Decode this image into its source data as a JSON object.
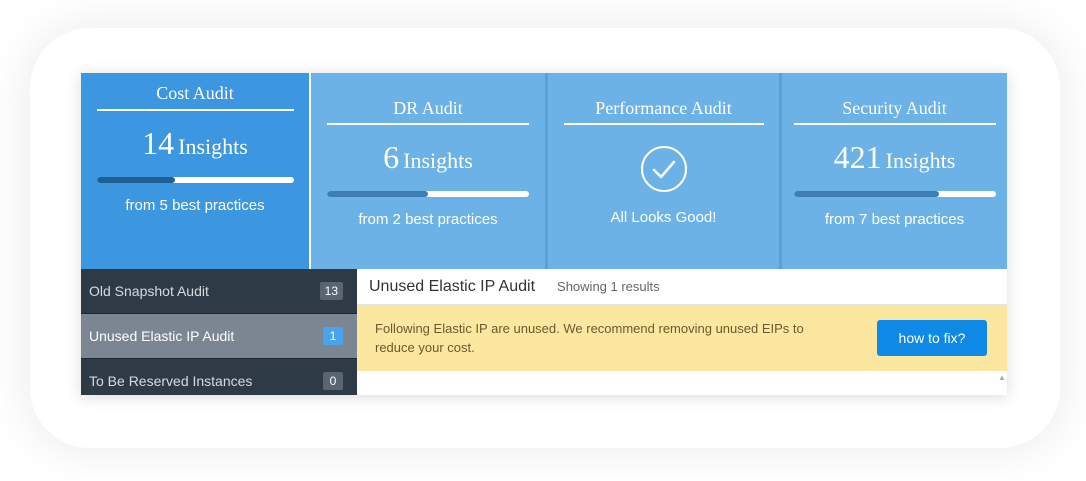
{
  "cards": [
    {
      "title": "Cost Audit",
      "count": "14",
      "unit": "Insights",
      "sub": "from 5 best practices",
      "progress": 0.4
    },
    {
      "title": "DR Audit",
      "count": "6",
      "unit": "Insights",
      "sub": "from 2 best practices",
      "progress": 0.5
    },
    {
      "title": "Performance Audit",
      "status": "All Looks Good!",
      "icon": "check-circle-icon"
    },
    {
      "title": "Security Audit",
      "count": "421",
      "unit": "Insights",
      "sub": "from 7 best practices",
      "progress": 0.72
    }
  ],
  "sidebar": {
    "items": [
      {
        "label": "Old Snapshot Audit",
        "count": "13"
      },
      {
        "label": "Unused Elastic IP Audit",
        "count": "1"
      },
      {
        "label": "To Be Reserved Instances",
        "count": "0"
      }
    ]
  },
  "main": {
    "title": "Unused Elastic IP Audit",
    "results": "Showing 1 results",
    "notice": "Following Elastic IP are unused. We recommend removing unused EIPs to reduce your cost.",
    "fix_label": "how to fix?"
  },
  "colors": {
    "card_active": "#3c96e0",
    "card": "#6cb2e6",
    "sidebar": "#2f3a47",
    "notice_bg": "#fbe7a0",
    "button": "#0e89e5"
  }
}
